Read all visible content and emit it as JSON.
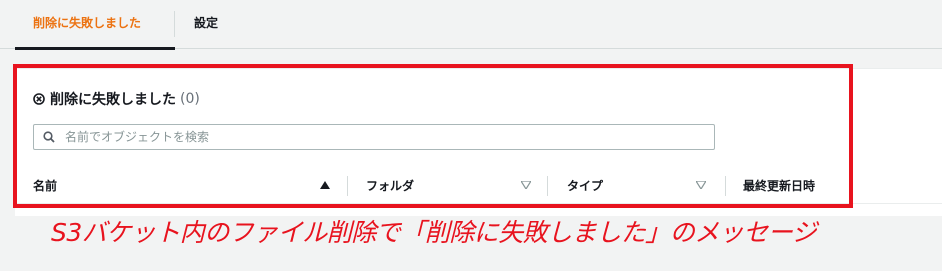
{
  "tabs": [
    {
      "label": "削除に失敗しました",
      "active": true
    },
    {
      "label": "設定",
      "active": false
    }
  ],
  "panel": {
    "title": "削除に失敗しました",
    "count": "(0)"
  },
  "search": {
    "placeholder": "名前でオブジェクトを検索",
    "value": ""
  },
  "table": {
    "columns": [
      "名前",
      "フォルダ",
      "タイプ",
      "最終更新日時"
    ]
  },
  "annotation": {
    "caption": "S3バケット内のファイル削除で「削除に失敗しました」のメッセージ"
  },
  "colors": {
    "accent": "#ec7211",
    "annotation_red": "#e8131e"
  }
}
